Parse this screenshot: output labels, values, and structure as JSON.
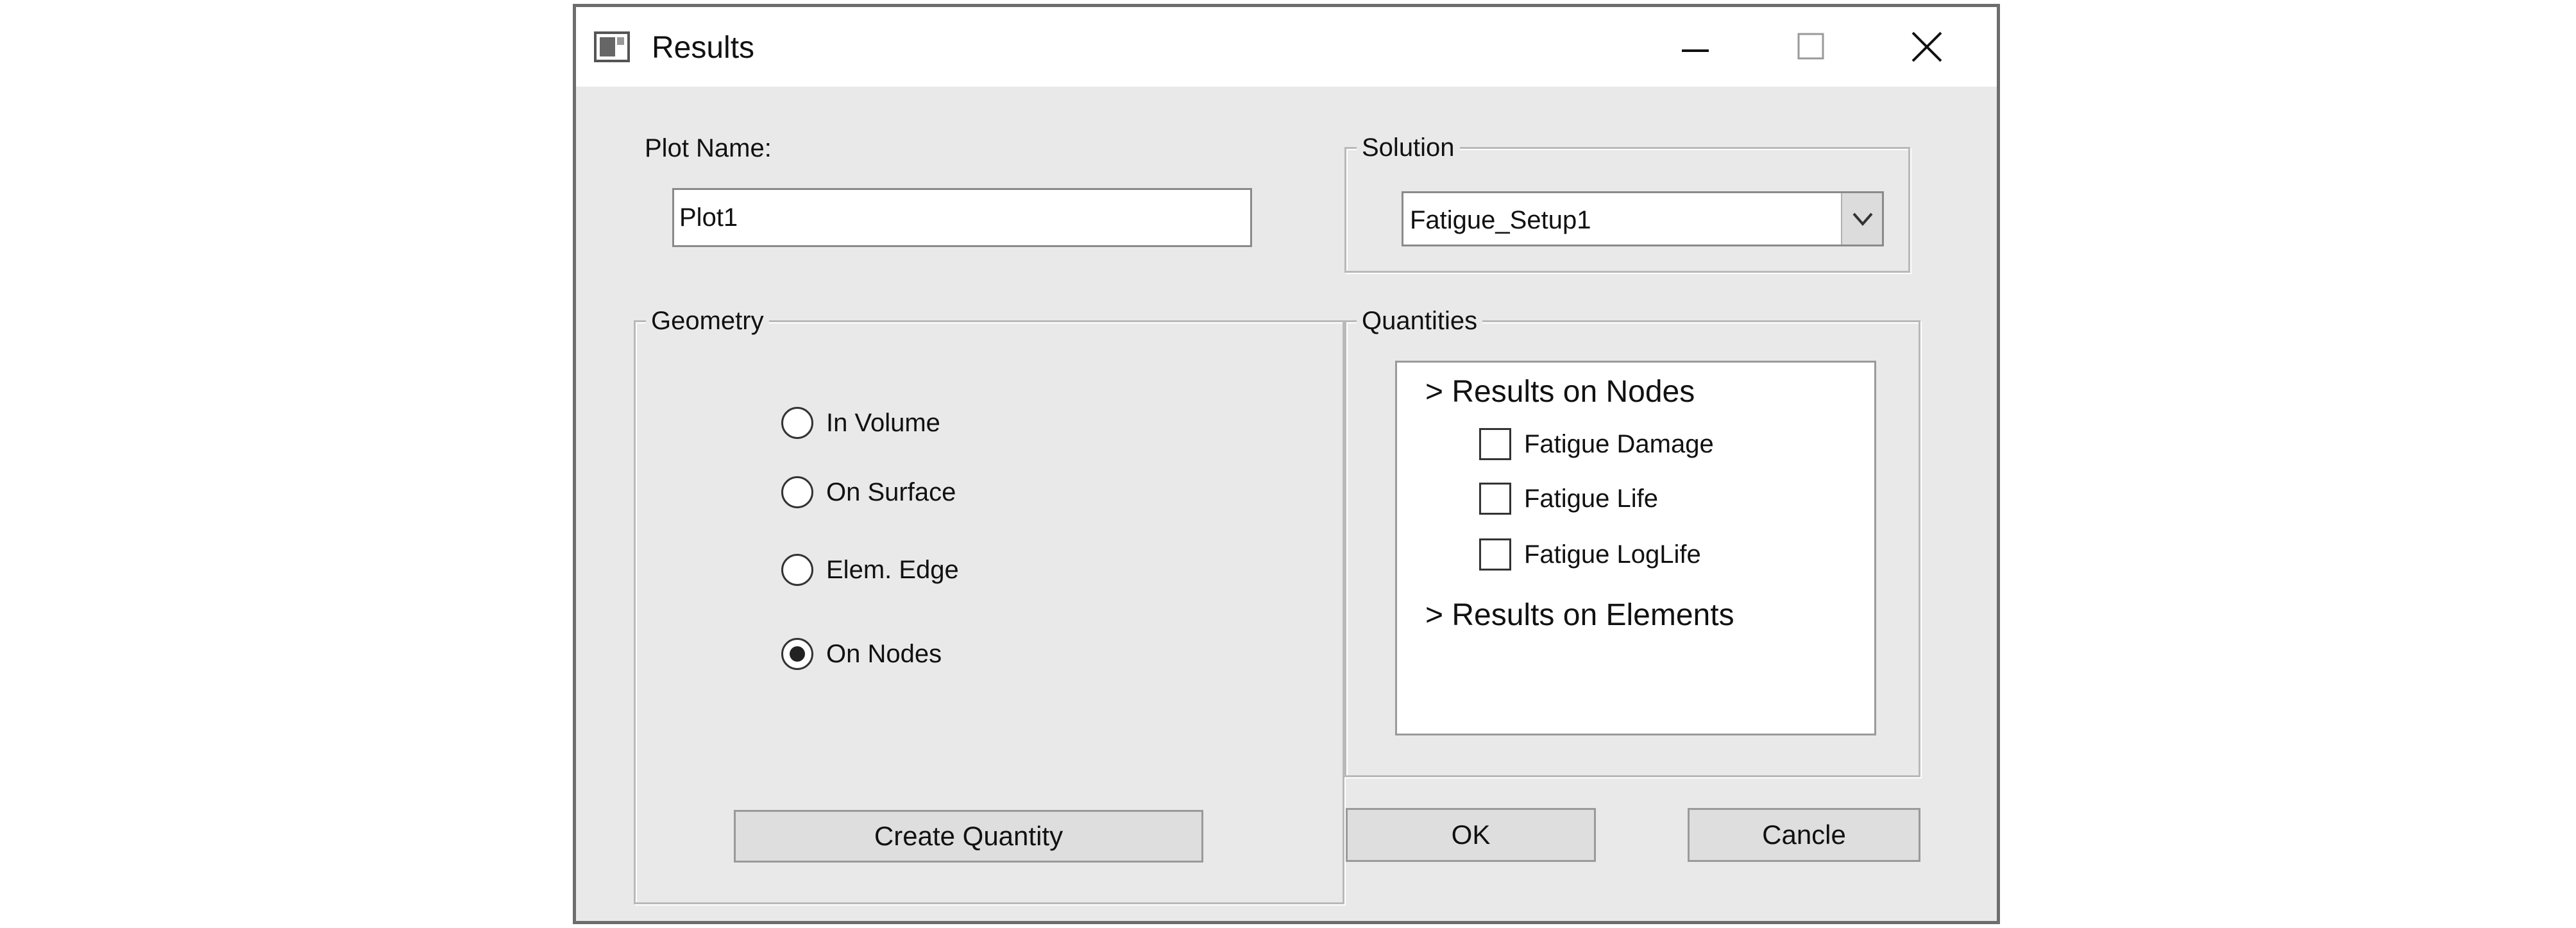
{
  "window": {
    "title": "Results",
    "icon": "window-app-icon",
    "controls": {
      "minimize": "minimize-icon",
      "maximize": "maximize-icon",
      "close": "close-icon"
    }
  },
  "plot_name": {
    "label": "Plot Name:",
    "value": "Plot1"
  },
  "solution": {
    "title": "Solution",
    "selected": "Fatigue_Setup1",
    "arrow_icon": "chevron-down-icon"
  },
  "geometry": {
    "title": "Geometry",
    "options": [
      {
        "label": "In Volume",
        "checked": false
      },
      {
        "label": "On Surface",
        "checked": false
      },
      {
        "label": "Elem. Edge",
        "checked": false
      },
      {
        "label": "On Nodes",
        "checked": true
      }
    ],
    "create_button": "Create Quantity"
  },
  "quantities": {
    "title": "Quantities",
    "nodes_header": "> Results on Nodes",
    "items": [
      {
        "label": "Fatigue Damage",
        "checked": false
      },
      {
        "label": "Fatigue Life",
        "checked": false
      },
      {
        "label": "Fatigue LogLife",
        "checked": false
      }
    ],
    "elements_header": "> Results on Elements"
  },
  "buttons": {
    "ok": "OK",
    "cancel": "Cancle"
  },
  "colors": {
    "window_bg": "#e9e9e9",
    "titlebar_bg": "#ffffff",
    "button_bg": "#dedede",
    "border": "#6d6d6d"
  }
}
